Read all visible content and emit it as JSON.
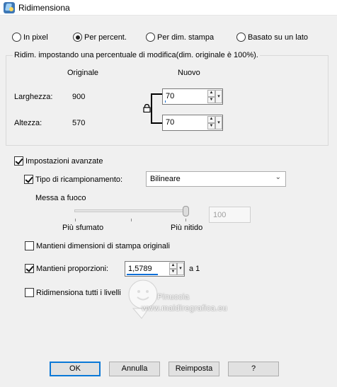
{
  "window": {
    "title": "Ridimensiona"
  },
  "mode_radios": [
    {
      "label": "In pixel",
      "checked": false
    },
    {
      "label": "Per percent.",
      "checked": true
    },
    {
      "label": "Per dim. stampa",
      "checked": false
    },
    {
      "label": "Basato su un lato",
      "checked": false
    }
  ],
  "size_group": {
    "title": "Ridim. impostando una percentuale di modifica(dim. originale è 100%).",
    "original_header": "Originale",
    "new_header": "Nuovo",
    "width_label": "Larghezza:",
    "width_original": "900",
    "width_new": "70",
    "height_label": "Altezza:",
    "height_original": "570",
    "height_new": "70"
  },
  "advanced": {
    "label": "Impostazioni avanzate",
    "checked": true,
    "resample_label": "Tipo di ricampionamento:",
    "resample_checked": true,
    "resample_value": "Bilineare",
    "sharpen_label": "Messa a fuoco",
    "sharpen_min_label": "Più sfumato",
    "sharpen_max_label": "Più nitido",
    "sharpen_value": "100",
    "keep_print_label": "Mantieni dimensioni di stampa originali",
    "keep_print_checked": false,
    "keep_ratio_label": "Mantieni proporzioni:",
    "keep_ratio_checked": true,
    "ratio_value": "1,5789",
    "ratio_suffix": "a 1",
    "resize_all_layers_label": "Ridimensiona tutti i livelli",
    "resize_all_layers_checked": false
  },
  "watermark": {
    "line1": "Pinuccia",
    "line2": "www.maidiregrafica.eu"
  },
  "buttons": {
    "ok": "OK",
    "cancel": "Annulla",
    "reset": "Reimposta",
    "help": "?"
  },
  "colors": {
    "accent": "#0a78d7",
    "background": "#f0f0f0"
  }
}
